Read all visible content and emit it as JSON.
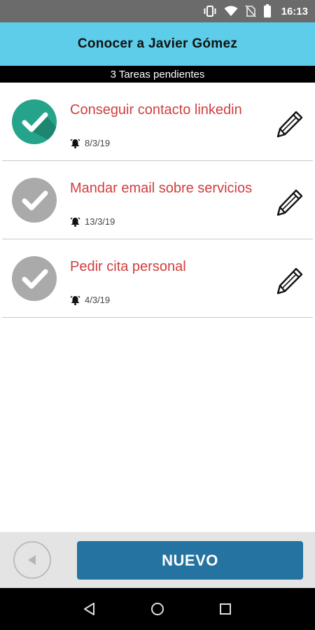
{
  "status_bar": {
    "time": "16:13",
    "icons": [
      "vibrate-icon",
      "wifi-icon",
      "no-sim-icon",
      "battery-icon"
    ]
  },
  "header": {
    "title": "Conocer a Javier Gómez",
    "pending": "3 Tareas pendientes"
  },
  "tasks": [
    {
      "title": "Conseguir contacto linkedin",
      "date": "8/3/19",
      "completed": true
    },
    {
      "title": "Mandar email sobre servicios",
      "date": "13/3/19",
      "completed": false
    },
    {
      "title": "Pedir cita personal",
      "date": "4/3/19",
      "completed": false
    }
  ],
  "bottom_bar": {
    "new_label": "NUEVO"
  },
  "colors": {
    "header_bg": "#5dcde9",
    "task_title": "#cf3e3e",
    "check_done": "#26a48b",
    "check_pending": "#aaaaaa",
    "primary_button": "#2573a0"
  }
}
